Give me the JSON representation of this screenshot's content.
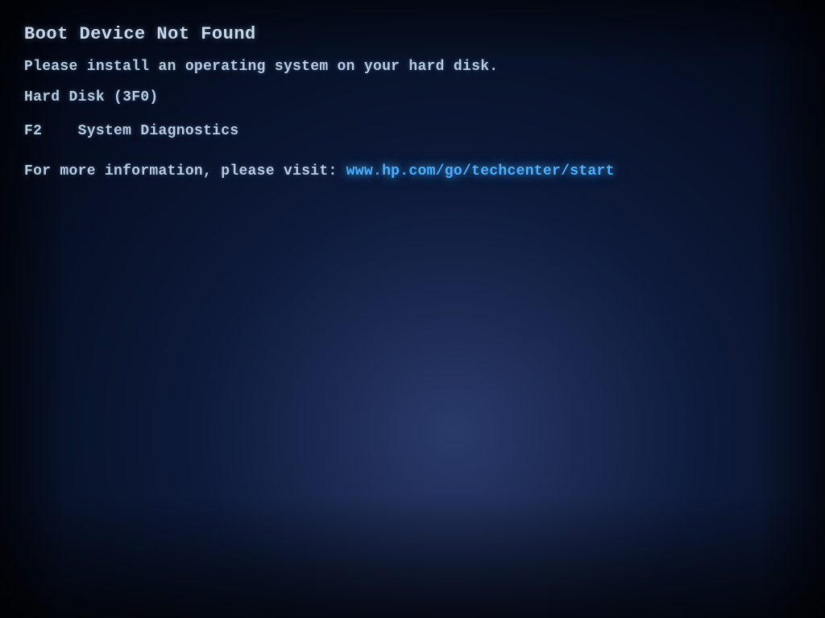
{
  "screen": {
    "title": "Boot Device Not Found",
    "install_message": "Please install an operating system on your hard disk.",
    "hard_disk_info": "Hard Disk (3F0)",
    "diagnostics_key": "F2",
    "diagnostics_label": "System Diagnostics",
    "more_info_prefix": "For more information, please visit:",
    "url": "www.hp.com/go/techcenter/start"
  }
}
